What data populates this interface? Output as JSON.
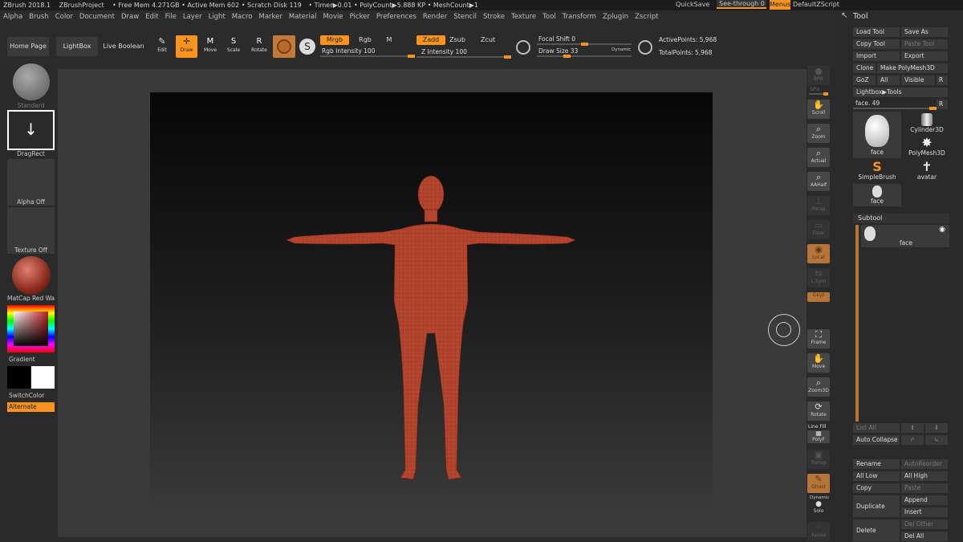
{
  "title_bar": {
    "app": "ZBrush 2018.1",
    "project": "ZBrushProject",
    "free_mem": "• Free Mem 4.271GB",
    "active_mem": "• Active Mem 602",
    "scratch": "• Scratch Disk 119",
    "timer": "• Timer▶0.01",
    "polycount": "• PolyCount▶5.888 KP",
    "meshcount": "• MeshCount▶1",
    "quicksave": "QuickSave",
    "see_through": "See-through  0",
    "menus": "Menus",
    "script": "DefaultZScript"
  },
  "menu": [
    "Alpha",
    "Brush",
    "Color",
    "Document",
    "Draw",
    "Edit",
    "File",
    "Layer",
    "Light",
    "Macro",
    "Marker",
    "Material",
    "Movie",
    "Picker",
    "Preferences",
    "Render",
    "Stencil",
    "Stroke",
    "Texture",
    "Tool",
    "Transform",
    "Zplugin",
    "Zscript"
  ],
  "toolbar": {
    "home": "Home Page",
    "lightbox": "LightBox",
    "live_boolean": "Live Boolean",
    "edit": "Edit",
    "draw": "Draw",
    "move": "Move",
    "scale": "Scale",
    "rotate": "Rotate",
    "mrgb": "Mrgb",
    "rgb": "Rgb",
    "m": "M",
    "zadd": "Zadd",
    "zsub": "Zsub",
    "zcut": "Zcut",
    "rgb_intensity": "Rgb Intensity 100",
    "z_intensity": "Z Intensity 100",
    "focal_shift": "Focal Shift 0",
    "draw_size": "Draw Size 33",
    "dynamic": "Dynamic",
    "active_points": "ActivePoints: 5,968",
    "total_points": "TotalPoints: 5,968",
    "rgb_intensity_level": 1.0,
    "z_intensity_level": 1.0,
    "focal_shift_level": 0.5,
    "draw_size_level": 0.3
  },
  "left": {
    "brush": "Standard",
    "stroke": "DragRect",
    "alpha": "Alpha Off",
    "texture": "Texture Off",
    "material": "MatCap Red Wax",
    "gradient": "Gradient",
    "switch": "SwitchColor",
    "alternate": "Alternate"
  },
  "dock": {
    "bpr": "BPR",
    "spix": "SPix",
    "scroll": "Scroll",
    "zoom": "Zoom",
    "actual": "Actual",
    "aahalf": "AAHalf",
    "persp": "Persp",
    "floor": "Floor",
    "local": "Local",
    "lsym": "L.Sym",
    "xyz": "Gxyz",
    "frame": "Frame",
    "move": "Move",
    "zoom3d": "Zoom3D",
    "rotate": "Rotate",
    "linefill": "Line Fill",
    "polyf": "PolyF",
    "transp": "Transp",
    "ghost": "Ghost",
    "dynamic": "Dynamic",
    "solo": "Solo",
    "xpose": "Xpose"
  },
  "tool": {
    "title": "Tool",
    "load": "Load Tool",
    "save_as": "Save As",
    "copy": "Copy Tool",
    "paste": "Paste Tool",
    "import": "Import",
    "export": "Export",
    "clone": "Clone",
    "make_poly": "Make PolyMesh3D",
    "goz": "GoZ",
    "all": "All",
    "visible": "Visible",
    "r": "R",
    "lightbox_tools": "Lightbox▶Tools",
    "face_slider": "face. 49",
    "face_slider_level": 1.0,
    "thumbs": [
      "face",
      "Cylinder3D",
      "PolyMesh3D",
      "SimpleBrush",
      "avatar",
      "face"
    ]
  },
  "subtool": {
    "title": "Subtool",
    "item": "face",
    "list_all": "List All",
    "auto_collapse": "Auto Collapse",
    "rename": "Rename",
    "autoreorder": "AutoReorder",
    "all_low": "All Low",
    "all_high": "All High",
    "copy": "Copy",
    "paste": "Paste",
    "duplicate": "Duplicate",
    "append": "Append",
    "insert": "Insert",
    "delete": "Delete",
    "del_other": "Del Other",
    "del_all": "Del All"
  },
  "colors": {
    "accent": "#f7931e",
    "mesh": "#b4452f"
  }
}
